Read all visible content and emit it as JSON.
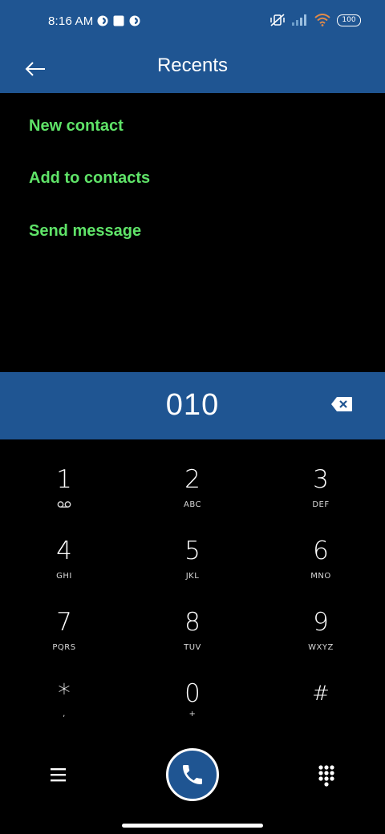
{
  "status_bar": {
    "time": "8:16 AM",
    "battery": "100"
  },
  "app_bar": {
    "title": "Recents",
    "back_icon": "arrow-back-icon"
  },
  "options": {
    "new_contact": "New contact",
    "add_to_contacts": "Add to contacts",
    "send_message": "Send message"
  },
  "number_display": {
    "number": "010",
    "backspace_icon": "backspace-icon"
  },
  "dialpad": {
    "keys": [
      {
        "digit": "1",
        "letters": ""
      },
      {
        "digit": "2",
        "letters": "ABC"
      },
      {
        "digit": "3",
        "letters": "DEF"
      },
      {
        "digit": "4",
        "letters": "GHI"
      },
      {
        "digit": "5",
        "letters": "JKL"
      },
      {
        "digit": "6",
        "letters": "MNO"
      },
      {
        "digit": "7",
        "letters": "PQRS"
      },
      {
        "digit": "8",
        "letters": "TUV"
      },
      {
        "digit": "9",
        "letters": "WXYZ"
      },
      {
        "digit": "*",
        "letters": ","
      },
      {
        "digit": "0",
        "letters": "+"
      },
      {
        "digit": "#",
        "letters": ""
      }
    ]
  },
  "bottom_bar": {
    "menu_icon": "menu-icon",
    "call_icon": "phone-icon",
    "dialpad_icon": "dialpad-icon"
  },
  "colors": {
    "primary": "#1f5592",
    "accent_green": "#5fe368",
    "background": "#000000"
  }
}
